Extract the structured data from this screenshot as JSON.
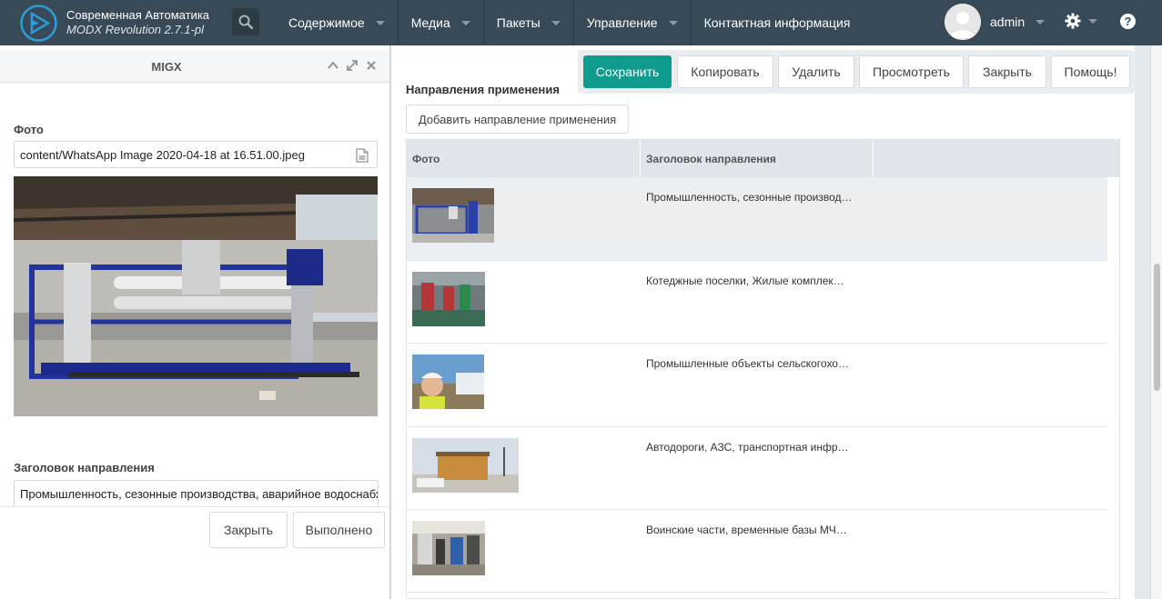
{
  "header": {
    "brand_title": "Современная Автоматика",
    "brand_subtitle": "MODX Revolution 2.7.1-pl",
    "nav": [
      "Содержимое",
      "Медиа",
      "Пакеты",
      "Управление",
      "Контактная информация"
    ],
    "user_name": "admin",
    "help_label": "?"
  },
  "toolbar": {
    "save": "Сохранить",
    "copy": "Копировать",
    "delete": "Удалить",
    "view": "Просмотреть",
    "close": "Закрыть",
    "help": "Помощь!"
  },
  "section": {
    "title": "Направления применения",
    "add_button": "Добавить направление применения"
  },
  "grid": {
    "columns": [
      "Фото",
      "Заголовок направления",
      ""
    ],
    "rows": [
      {
        "title": "Промышленность, сезонные производ…",
        "selected": true
      },
      {
        "title": "Котеджные поселки, Жилые комплек…",
        "selected": false
      },
      {
        "title": "Промышленные объекты сельскогохо…",
        "selected": false
      },
      {
        "title": "Автодороги, АЗС, транспортная инфр…",
        "selected": false
      },
      {
        "title": "Воинские части, временные базы МЧ…",
        "selected": false
      }
    ]
  },
  "migx": {
    "title": "MIGX",
    "photo_label": "Фото",
    "photo_value": "content/WhatsApp Image 2020-04-18 at 16.51.00.jpeg",
    "heading_label": "Заголовок направления",
    "heading_value": "Промышленность, сезонные производства, аварийное водоснабжение",
    "close_button": "Закрыть",
    "done_button": "Выполнено"
  },
  "colors": {
    "topbar": "#384a57",
    "primary": "#0f9b8e"
  }
}
